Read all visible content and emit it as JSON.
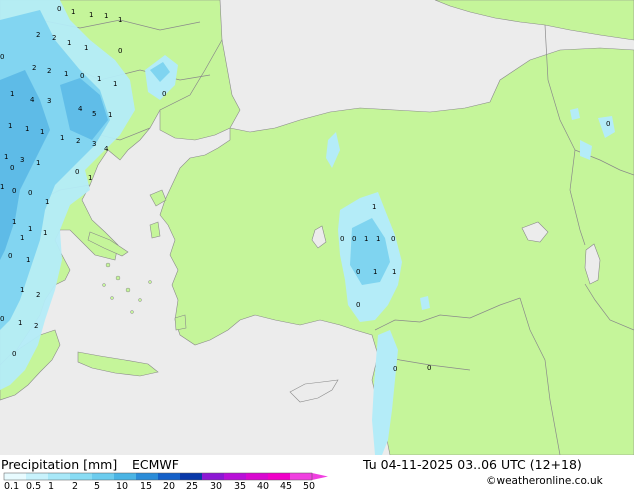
{
  "map": {
    "colors": {
      "sea": "#ececec",
      "land": "#c5f59a",
      "border": "#8a8a8a",
      "precip_light": "#b4ecf8",
      "precip_mid": "#7fd4f0",
      "precip_heavy": "#5ab8e6"
    },
    "precip_labels": [
      "0",
      "1",
      "1",
      "1",
      "1",
      "2",
      "2",
      "1",
      "1",
      "0",
      "0",
      "2",
      "2",
      "1",
      "0",
      "1",
      "0",
      "1",
      "1",
      "4",
      "3",
      "5",
      "1",
      "4",
      "1",
      "1",
      "1",
      "1",
      "2",
      "3",
      "4",
      "1",
      "0",
      "1",
      "3",
      "0",
      "1",
      "1",
      "0",
      "0",
      "1",
      "1",
      "1",
      "1",
      "1",
      "0",
      "1",
      "1",
      "2",
      "0",
      "1",
      "2",
      "0",
      "1",
      "0",
      "0",
      "1",
      "1",
      "0",
      "0",
      "1",
      "1",
      "0",
      "0",
      "0",
      "0"
    ]
  },
  "footer": {
    "title": "Precipitation [mm]",
    "model": "ECMWF",
    "datetime": "Tu 04-11-2025 03..06 UTC (12+18)",
    "credit": "©weatheronline.co.uk",
    "legend": {
      "ticks": [
        "0.1",
        "0.5",
        "1",
        "2",
        "5",
        "10",
        "15",
        "20",
        "25",
        "30",
        "35",
        "40",
        "45",
        "50"
      ],
      "colors": [
        "#e8fbff",
        "#c8f2fc",
        "#a8e8f8",
        "#88dcf4",
        "#6cccee",
        "#4ab4e4",
        "#2a8cd8",
        "#1460c8",
        "#0838a8",
        "#8c18d4",
        "#b810d8",
        "#d808d0",
        "#f000c8",
        "#f040e0"
      ]
    }
  }
}
